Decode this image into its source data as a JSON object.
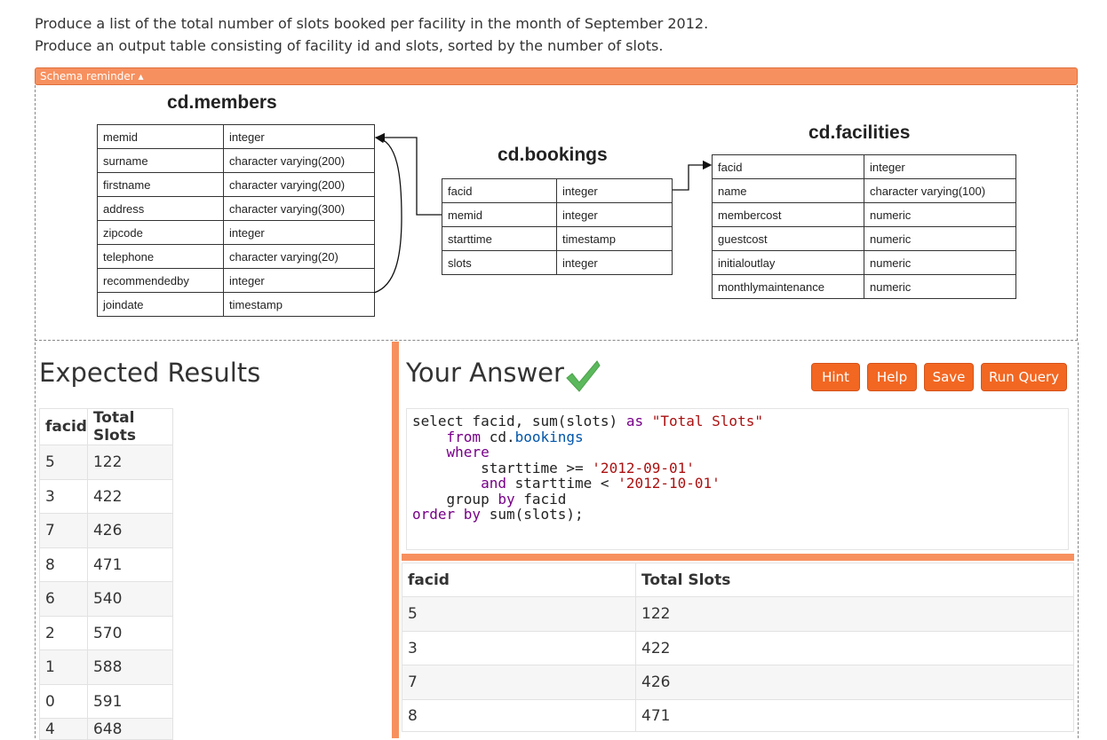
{
  "question": {
    "line1": "Produce a list of the total number of slots booked per facility in the month of September 2012.",
    "line2": "Produce an output table consisting of facility id and slots, sorted by the number of slots."
  },
  "schema_reminder": {
    "label": "Schema reminder ▴"
  },
  "schema": {
    "members": {
      "title": "cd.members",
      "rows": [
        {
          "col": "memid",
          "type": "integer"
        },
        {
          "col": "surname",
          "type": "character varying(200)"
        },
        {
          "col": "firstname",
          "type": "character varying(200)"
        },
        {
          "col": "address",
          "type": "character varying(300)"
        },
        {
          "col": "zipcode",
          "type": "integer"
        },
        {
          "col": "telephone",
          "type": "character varying(20)"
        },
        {
          "col": "recommendedby",
          "type": "integer"
        },
        {
          "col": "joindate",
          "type": "timestamp"
        }
      ]
    },
    "bookings": {
      "title": "cd.bookings",
      "rows": [
        {
          "col": "facid",
          "type": "integer"
        },
        {
          "col": "memid",
          "type": "integer"
        },
        {
          "col": "starttime",
          "type": "timestamp"
        },
        {
          "col": "slots",
          "type": "integer"
        }
      ]
    },
    "facilities": {
      "title": "cd.facilities",
      "rows": [
        {
          "col": "facid",
          "type": "integer"
        },
        {
          "col": "name",
          "type": "character varying(100)"
        },
        {
          "col": "membercost",
          "type": "numeric"
        },
        {
          "col": "guestcost",
          "type": "numeric"
        },
        {
          "col": "initialoutlay",
          "type": "numeric"
        },
        {
          "col": "monthlymaintenance",
          "type": "numeric"
        }
      ]
    }
  },
  "expected": {
    "heading": "Expected Results",
    "headers": [
      "facid",
      "Total Slots"
    ],
    "rows": [
      [
        "5",
        "122"
      ],
      [
        "3",
        "422"
      ],
      [
        "7",
        "426"
      ],
      [
        "8",
        "471"
      ],
      [
        "6",
        "540"
      ],
      [
        "2",
        "570"
      ],
      [
        "1",
        "588"
      ],
      [
        "0",
        "591"
      ],
      [
        "4",
        "648"
      ]
    ]
  },
  "answer": {
    "heading": "Your Answer",
    "buttons": {
      "hint": "Hint",
      "help": "Help",
      "save": "Save",
      "run": "Run Query"
    },
    "code": {
      "l1": [
        "select facid, sum(slots) ",
        "as",
        " ",
        "\"Total Slots\""
      ],
      "l2": [
        "    ",
        "from",
        " cd.",
        "bookings"
      ],
      "l3": [
        "    ",
        "where"
      ],
      "l4": [
        "        starttime >= ",
        "'2012-09-01'"
      ],
      "l5": [
        "        ",
        "and",
        " starttime < ",
        "'2012-10-01'"
      ],
      "l6": [
        "    group ",
        "by",
        " facid"
      ],
      "l7": [
        "order ",
        "by",
        " sum(slots);"
      ]
    },
    "headers": [
      "facid",
      "Total Slots"
    ],
    "rows": [
      [
        "5",
        "122"
      ],
      [
        "3",
        "422"
      ],
      [
        "7",
        "426"
      ],
      [
        "8",
        "471"
      ]
    ]
  },
  "colors": {
    "accent": "#f7905f",
    "button": "#f26722",
    "check": "#5cb85c"
  }
}
